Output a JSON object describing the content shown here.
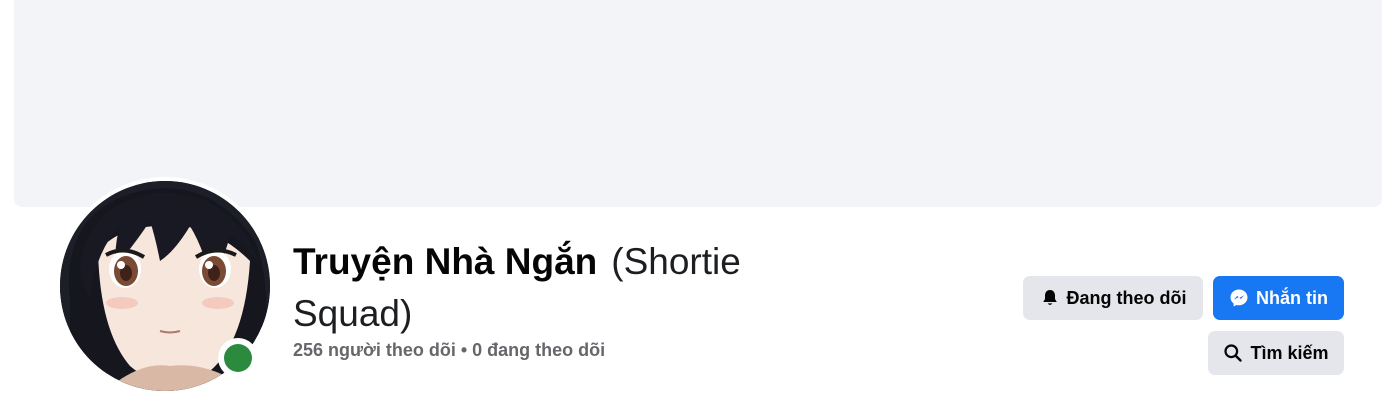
{
  "profile": {
    "name": "Truyện Nhà Ngắn",
    "alternate_name": "(Shortie Squad)",
    "stats": "256 người theo dõi • 0 đang theo dõi",
    "online": true
  },
  "actions": {
    "following_label": "Đang theo dõi",
    "message_label": "Nhắn tin",
    "search_label": "Tìm kiếm"
  },
  "colors": {
    "cover": "#f2f4f7",
    "primary": "#1877f2",
    "secondary_button": "#e4e6eb",
    "online": "#2b8a3e"
  },
  "icons": {
    "following": "bell-icon",
    "message": "messenger-icon",
    "search": "search-icon"
  }
}
